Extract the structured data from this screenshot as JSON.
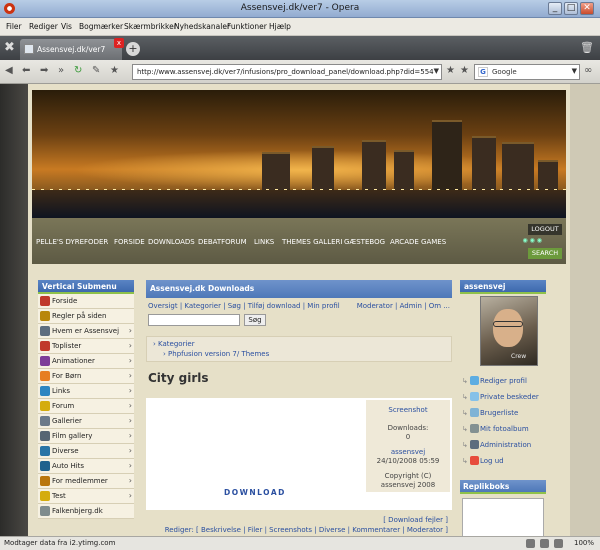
{
  "window": {
    "title": "Assensvej.dk/ver7 - Opera"
  },
  "menu": [
    "Filer",
    "Rediger",
    "Vis",
    "Bogmærker",
    "Skærmbrikker",
    "Nyhedskanaler",
    "Funktioner",
    "Hjælp"
  ],
  "tab": {
    "label": "Assensvej.dk/ver7",
    "close": "x"
  },
  "address": {
    "url": "http://www.assensvej.dk/ver7/infusions/pro_download_panel/download.php?did=554"
  },
  "search_engine": {
    "label": "Google"
  },
  "nav": {
    "links": [
      "PELLE'S DYREFODER",
      "FORSIDE",
      "DOWNLOADS",
      "DEBATFORUM",
      "LINKS",
      "THEMES GALLERI",
      "GÆSTEBOG",
      "ARCADE GAMES"
    ],
    "logout": "LOGOUT",
    "search": "SEARCH"
  },
  "sidebar": {
    "title": "Vertical Submenu",
    "items": [
      {
        "label": "Forside",
        "color": "#c0392b",
        "chevron": false
      },
      {
        "label": "Regler på siden",
        "color": "#b8860b",
        "chevron": false
      },
      {
        "label": "Hvem er Assensvej",
        "color": "#5d6d7e",
        "chevron": true
      },
      {
        "label": "Toplister",
        "color": "#c0392b",
        "chevron": true
      },
      {
        "label": "Animationer",
        "color": "#7d3c98",
        "chevron": true
      },
      {
        "label": "For Børn",
        "color": "#e67e22",
        "chevron": true
      },
      {
        "label": "Links",
        "color": "#2e86c1",
        "chevron": true
      },
      {
        "label": "Forum",
        "color": "#d4ac0d",
        "chevron": true
      },
      {
        "label": "Gallerier",
        "color": "#6c7a89",
        "chevron": true
      },
      {
        "label": "Film gallery",
        "color": "#566573",
        "chevron": true
      },
      {
        "label": "Diverse",
        "color": "#2874a6",
        "chevron": true
      },
      {
        "label": "Auto Hits",
        "color": "#1f618d",
        "chevron": true
      },
      {
        "label": "For medlemmer",
        "color": "#b9770e",
        "chevron": true
      },
      {
        "label": "Test",
        "color": "#d4ac0d",
        "chevron": true
      },
      {
        "label": "Falkenbjerg.dk",
        "color": "#7f8c8d",
        "chevron": false
      }
    ]
  },
  "center": {
    "title": "Assensvej.dk Downloads",
    "links_left": "Oversigt | Kategorier | Søg | Tilføj download | Min profil",
    "links_right": "Moderator | Admin | Om ...",
    "search_button": "Søg",
    "category_link": "Kategorier",
    "subcategory": "Phpfusion version 7/ Themes",
    "heading": "City girls",
    "screenshot_label": "Screenshot",
    "downloads_label": "Downloads:",
    "downloads_count": "0",
    "author": "assensvej",
    "date": "24/10/2008 05:59",
    "copyright_label": "Copyright (C)",
    "copyright_value": "assensvej 2008",
    "download_link": "DOWNLOAD",
    "report_error": "[ Download fejler ]",
    "edit_line": "Rediger: [ Beskrivelse | Filer | Screenshots | Diverse | Kommentarer | Moderator ]"
  },
  "user": {
    "name": "assensvej",
    "avatar_text": "Crew",
    "links": [
      {
        "label": "Rediger profil",
        "color": "#5dade2"
      },
      {
        "label": "Private beskeder",
        "color": "#85c1e9"
      },
      {
        "label": "Brugerliste",
        "color": "#7fb3d5"
      },
      {
        "label": "Mit fotoalbum",
        "color": "#839192"
      },
      {
        "label": "Administration",
        "color": "#5d6d7e"
      },
      {
        "label": "Log ud",
        "color": "#e74c3c"
      }
    ],
    "replik_title": "Replikboks"
  },
  "status": {
    "text": "Modtager data fra i2.ytimg.com",
    "zoom": "100%"
  }
}
